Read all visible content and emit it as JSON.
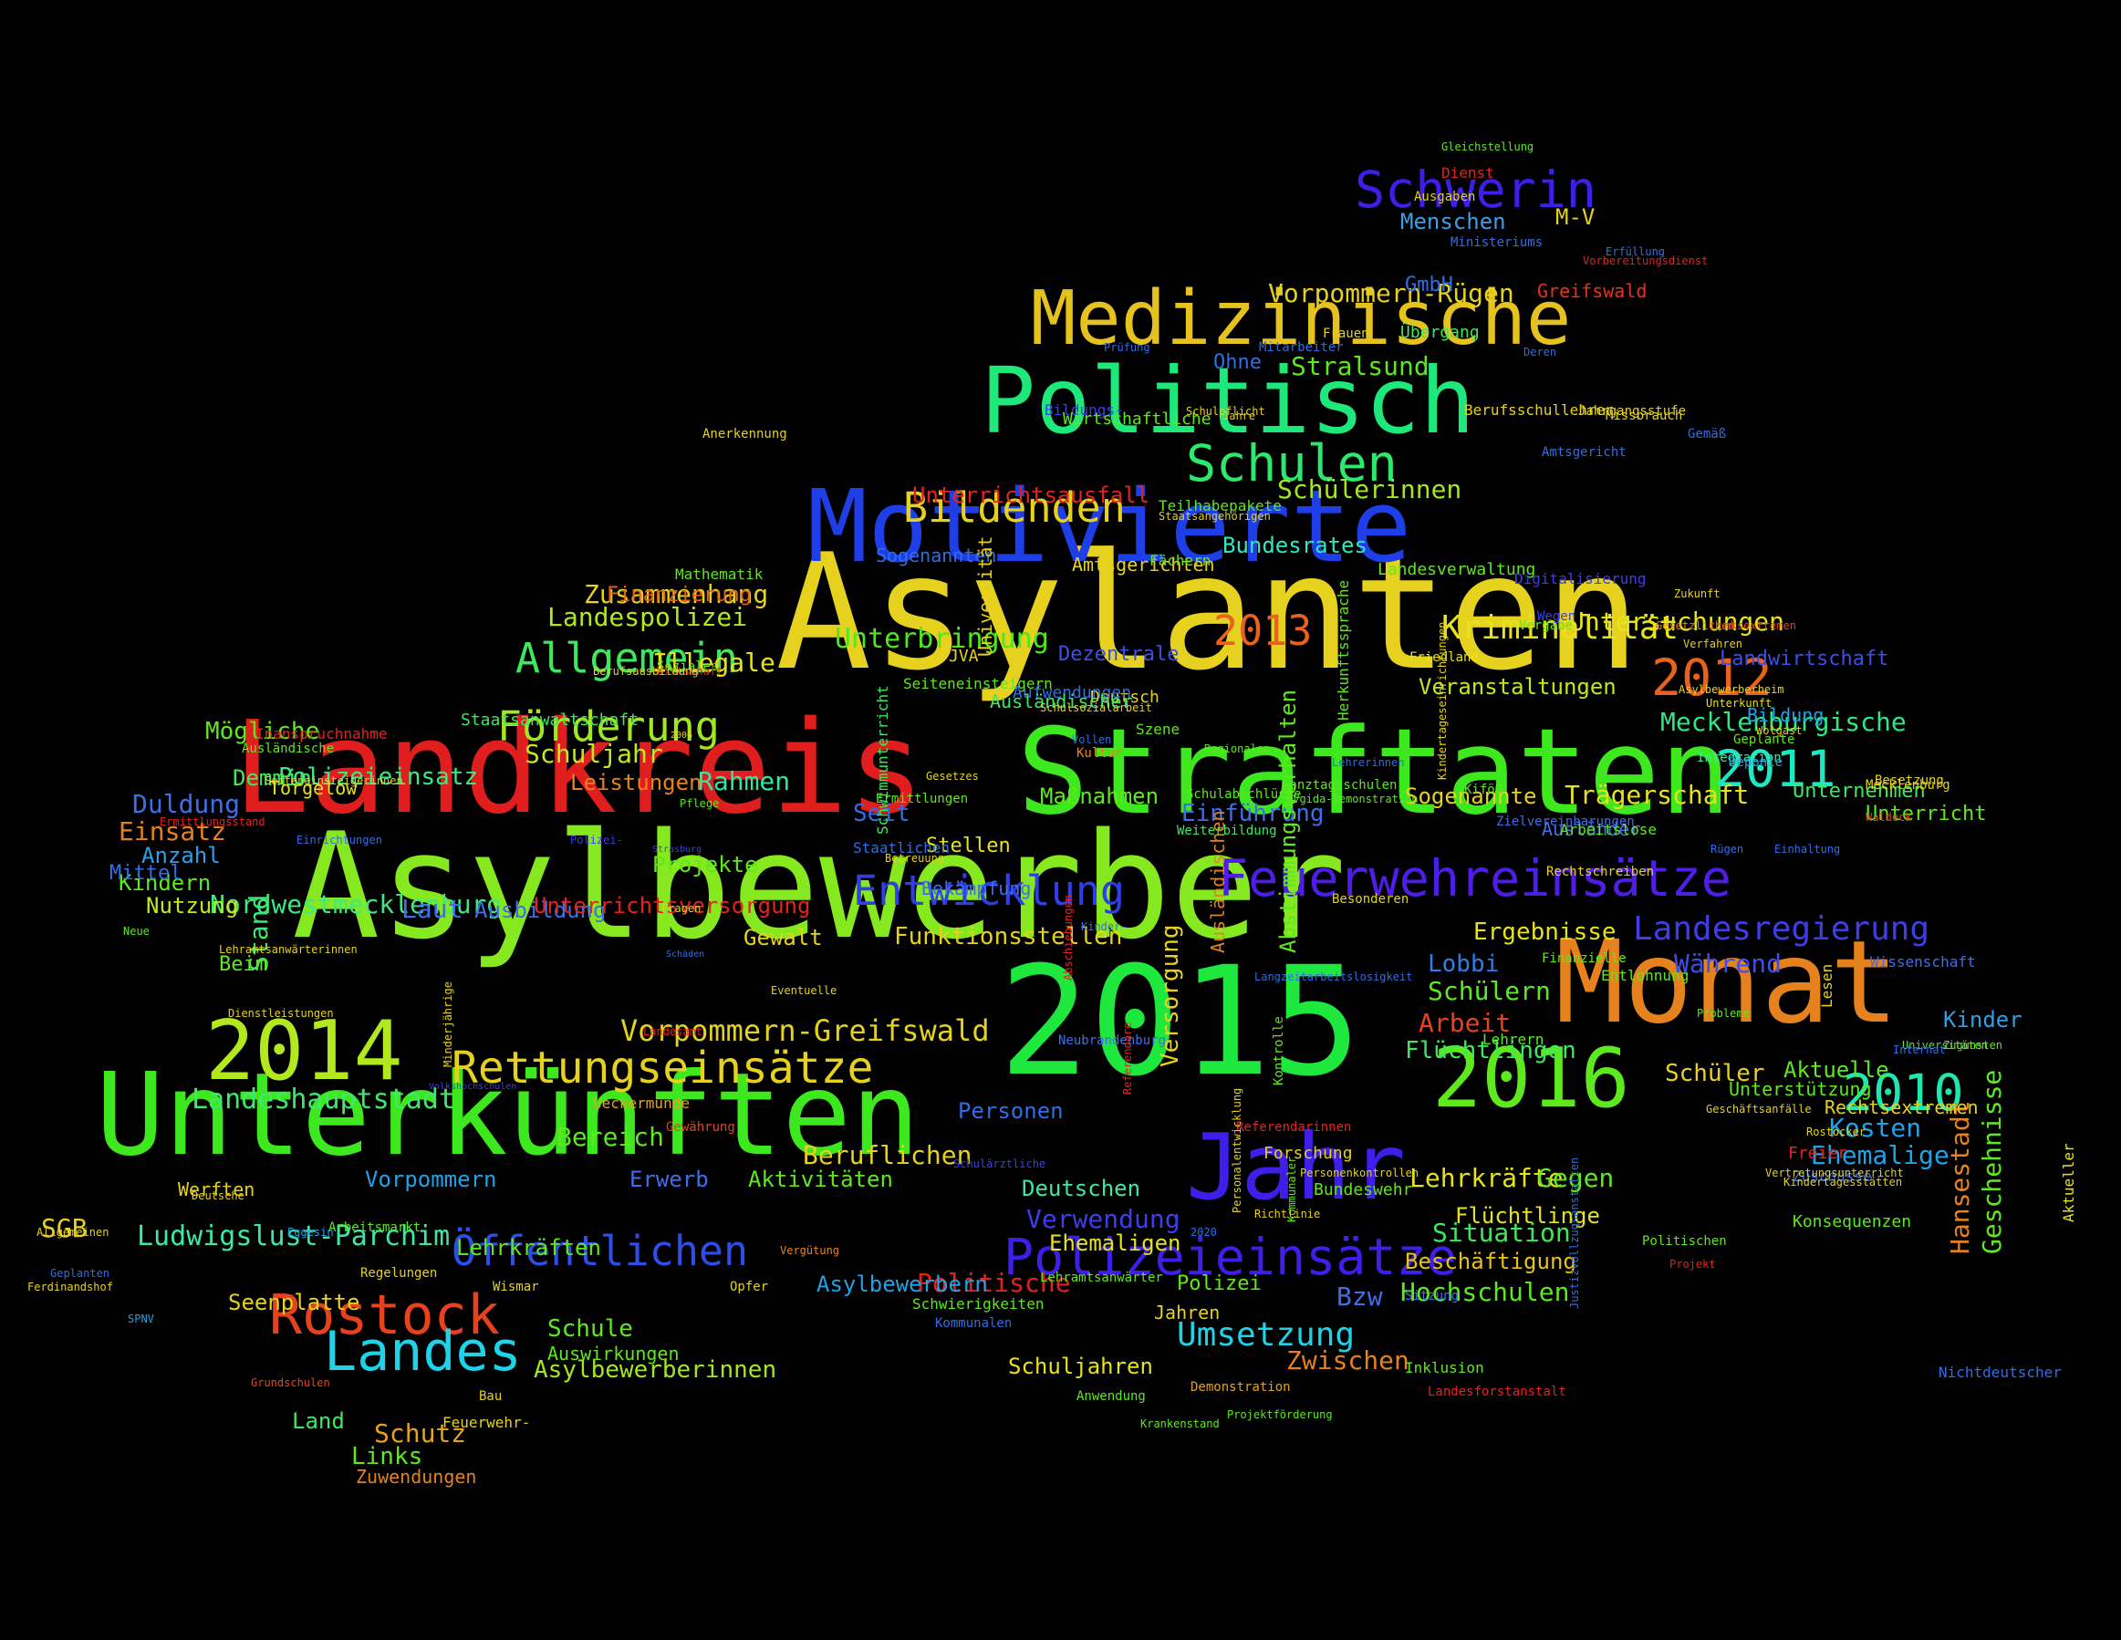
{
  "words": [
    {
      "text": "Asylanten",
      "color": "#e6d21e"
    },
    {
      "text": "Asylbewerber",
      "color": "#86e81e"
    },
    {
      "text": "Landkreis",
      "color": "#e01e1e"
    },
    {
      "text": "Straftaten",
      "color": "#3ee81e"
    },
    {
      "text": "Unterkünften",
      "color": "#3ee81e"
    },
    {
      "text": "2015",
      "color": "#1ee83e"
    },
    {
      "text": "Monat",
      "color": "#e6821e"
    },
    {
      "text": "Motivierte",
      "color": "#1e3ee8"
    },
    {
      "text": "Politisch",
      "color": "#1ee87a"
    },
    {
      "text": "Medizinische",
      "color": "#e6c21e"
    },
    {
      "text": "Jahr",
      "color": "#3e1ee8"
    },
    {
      "text": "2014",
      "color": "#b2e81e"
    },
    {
      "text": "2016",
      "color": "#5ee81e"
    },
    {
      "text": "Rostock",
      "color": "#e6421e"
    },
    {
      "text": "Landes",
      "color": "#1ed2e8"
    },
    {
      "text": "Schwerin",
      "color": "#3e1ee8"
    },
    {
      "text": "Schulen",
      "color": "#2ee86e"
    },
    {
      "text": "Feuerwehreinsätze",
      "color": "#4e1ee8"
    },
    {
      "text": "Polizeieinsätze",
      "color": "#3e1ee8"
    },
    {
      "text": "Rettungseinsätze",
      "color": "#e6d21e"
    },
    {
      "text": "Entwicklung",
      "color": "#2e3ee8"
    },
    {
      "text": "Allgemein",
      "color": "#3ee85e"
    },
    {
      "text": "Förderung",
      "color": "#a2e81e"
    },
    {
      "text": "Bildenden",
      "color": "#e6d21e"
    },
    {
      "text": "2013",
      "color": "#e6621e"
    },
    {
      "text": "2012",
      "color": "#e6621e"
    },
    {
      "text": "2011",
      "color": "#1ee8c2"
    },
    {
      "text": "2010",
      "color": "#1ee8b2"
    },
    {
      "text": "Öffentlichen",
      "color": "#2e4ee8"
    },
    {
      "text": "Vorpommern-Greifswald",
      "color": "#e6d21e"
    },
    {
      "text": "Kriminalität",
      "color": "#e6e21e"
    },
    {
      "text": "Landesregierung",
      "color": "#3e3ee8"
    },
    {
      "text": "Unterbringung",
      "color": "#4ee81e"
    },
    {
      "text": "Umsetzung",
      "color": "#1ed2e8"
    },
    {
      "text": "Landeshauptstadt",
      "color": "#3ee86e"
    },
    {
      "text": "Ludwigslust-Parchim",
      "color": "#3ee8a2"
    },
    {
      "text": "Nordwestmecklenburg",
      "color": "#3ee882"
    },
    {
      "text": "Vorpommern-Rügen",
      "color": "#e6d21e"
    },
    {
      "text": "Mecklenburgische",
      "color": "#2ee882"
    },
    {
      "text": "Zusammenhang",
      "color": "#e6d21e"
    },
    {
      "text": "Landespolizei",
      "color": "#b2e81e"
    },
    {
      "text": "Illegale",
      "color": "#e6e21e"
    },
    {
      "text": "Schuljahr",
      "color": "#c2e81e"
    },
    {
      "text": "Polizeieinsatz",
      "color": "#3ee882"
    },
    {
      "text": "Rahmen",
      "color": "#2ee8a2"
    },
    {
      "text": "Leistungen",
      "color": "#e6821e"
    },
    {
      "text": "Mögliche",
      "color": "#5ee81e"
    },
    {
      "text": "Demmin",
      "color": "#3ee85e"
    },
    {
      "text": "Duldung",
      "color": "#3e6ee8"
    },
    {
      "text": "Einsatz",
      "color": "#e6821e"
    },
    {
      "text": "Anzahl",
      "color": "#2e9ee8"
    },
    {
      "text": "Kindern",
      "color": "#5ee81e"
    },
    {
      "text": "Nutzung",
      "color": "#c2e81e"
    },
    {
      "text": "Stand",
      "color": "#3ee86e"
    },
    {
      "text": "Beim",
      "color": "#5ee81e"
    },
    {
      "text": "Laut",
      "color": "#3e6ee8"
    },
    {
      "text": "Ausbildung",
      "color": "#3e6ee8"
    },
    {
      "text": "Unterrichtsversorgung",
      "color": "#e6221e"
    },
    {
      "text": "Unterrichtsausfall",
      "color": "#e6221e"
    },
    {
      "text": "Stralsund",
      "color": "#5ee81e"
    },
    {
      "text": "Ohne",
      "color": "#2e6ee8"
    },
    {
      "text": "Schülerinnen",
      "color": "#a2e81e"
    },
    {
      "text": "Bundesrates",
      "color": "#2ee8c2"
    },
    {
      "text": "Gewalt",
      "color": "#e6d21e"
    },
    {
      "text": "Funktionsstellen",
      "color": "#e6d21e"
    },
    {
      "text": "Versorgung",
      "color": "#e6d21e"
    },
    {
      "text": "Ergebnisse",
      "color": "#e6e21e"
    },
    {
      "text": "Lobbi",
      "color": "#2e7ee8"
    },
    {
      "text": "Schülern",
      "color": "#5ee81e"
    },
    {
      "text": "Während",
      "color": "#3e4ee8"
    },
    {
      "text": "Arbeit",
      "color": "#e6421e"
    },
    {
      "text": "Flüchtlingen",
      "color": "#3ee85e"
    },
    {
      "text": "Schüler",
      "color": "#e6d21e"
    },
    {
      "text": "Aktuelle",
      "color": "#5ee81e"
    },
    {
      "text": "Kinder",
      "color": "#2e9ee8"
    },
    {
      "text": "Kosten",
      "color": "#1ea2e8"
    },
    {
      "text": "Ehemalige",
      "color": "#1ea2e8"
    },
    {
      "text": "Hansestadt",
      "color": "#e6821e"
    },
    {
      "text": "Geschehnisse",
      "color": "#5ee81e"
    },
    {
      "text": "Personen",
      "color": "#2e6ee8"
    },
    {
      "text": "Bereich",
      "color": "#5ee81e"
    },
    {
      "text": "Beruflichen",
      "color": "#e6d21e"
    },
    {
      "text": "Aktivitäten",
      "color": "#5ee81e"
    },
    {
      "text": "Erwerb",
      "color": "#3e6ee8"
    },
    {
      "text": "Vorpommern",
      "color": "#1ea2e8"
    },
    {
      "text": "Deutschen",
      "color": "#3ee8a2"
    },
    {
      "text": "Verwendung",
      "color": "#3e3ee8"
    },
    {
      "text": "Ehemaligen",
      "color": "#e6e21e"
    },
    {
      "text": "Lehrkräfte",
      "color": "#e6e21e"
    },
    {
      "text": "Gegen",
      "color": "#5ee81e"
    },
    {
      "text": "Flüchtlinge",
      "color": "#e6e21e"
    },
    {
      "text": "Situation",
      "color": "#3ee85e"
    },
    {
      "text": "Beschäftigung",
      "color": "#e6c21e"
    },
    {
      "text": "Hochschulen",
      "color": "#5ee81e"
    },
    {
      "text": "Bzw",
      "color": "#3e6ee8"
    },
    {
      "text": "Zwischen",
      "color": "#e6821e"
    },
    {
      "text": "Politische",
      "color": "#e6221e"
    },
    {
      "text": "Polizei",
      "color": "#5ee81e"
    },
    {
      "text": "Jahren",
      "color": "#e6d21e"
    },
    {
      "text": "Schuljahren",
      "color": "#e6e21e"
    },
    {
      "text": "Asylbewerbern",
      "color": "#1ea2e8"
    },
    {
      "text": "Schule",
      "color": "#5ee81e"
    },
    {
      "text": "Auswirkungen",
      "color": "#5ee81e"
    },
    {
      "text": "Asylbewerberinnen",
      "color": "#a2e81e"
    },
    {
      "text": "Seenplatte",
      "color": "#e6d21e"
    },
    {
      "text": "Lehrkräften",
      "color": "#5ee81e"
    },
    {
      "text": "SGB",
      "color": "#e6d21e"
    },
    {
      "text": "Land",
      "color": "#3ee85e"
    },
    {
      "text": "Schutz",
      "color": "#e6a21e"
    },
    {
      "text": "Links",
      "color": "#5ee81e"
    },
    {
      "text": "Zuwendungen",
      "color": "#e6821e"
    },
    {
      "text": "Veranstaltungen",
      "color": "#c2e81e"
    },
    {
      "text": "Landwirtschaft",
      "color": "#3e4ee8"
    },
    {
      "text": "Bildung",
      "color": "#1ea2e8"
    },
    {
      "text": "Sogenannte",
      "color": "#e6d21e"
    },
    {
      "text": "Trägerschaft",
      "color": "#e6e21e"
    },
    {
      "text": "Ausländer",
      "color": "#3e6ee8"
    },
    {
      "text": "Unternehmen",
      "color": "#3ee85e"
    },
    {
      "text": "Unterricht",
      "color": "#5ee81e"
    },
    {
      "text": "Einführung",
      "color": "#3e6ee8"
    },
    {
      "text": "Maßnahmen",
      "color": "#5ee81e"
    },
    {
      "text": "Dezentrale",
      "color": "#3e4ee8"
    },
    {
      "text": "Untersuchungen",
      "color": "#e6e21e"
    },
    {
      "text": "Finanzierung",
      "color": "#e6621e"
    },
    {
      "text": "Seit",
      "color": "#2e6ee8"
    },
    {
      "text": "Stellen",
      "color": "#e6e21e"
    },
    {
      "text": "Bekämpfung",
      "color": "#3e6ee8"
    },
    {
      "text": "Projekte",
      "color": "#5ee81e"
    },
    {
      "text": "M-V",
      "color": "#e6d21e"
    },
    {
      "text": "GmbH",
      "color": "#2e6ee8"
    },
    {
      "text": "Menschen",
      "color": "#3e9ee8"
    },
    {
      "text": "Greifswald",
      "color": "#e6321e"
    },
    {
      "text": "Mittel",
      "color": "#2e6ee8"
    },
    {
      "text": "Sogenannten",
      "color": "#2e6ee8"
    },
    {
      "text": "Amtsgerichten",
      "color": "#e6d21e"
    },
    {
      "text": "Vergabe",
      "color": "#5ee81e"
    },
    {
      "text": "Torgelow",
      "color": "#e6e21e"
    },
    {
      "text": "Staatsanwaltschaft",
      "color": "#3ee85e"
    },
    {
      "text": "Gleichstellung",
      "color": "#5ee81e"
    },
    {
      "text": "Dienst",
      "color": "#e6221e"
    },
    {
      "text": "Ausgaben",
      "color": "#e6d21e"
    },
    {
      "text": "Ministeriums",
      "color": "#2e6ee8"
    },
    {
      "text": "Frauen",
      "color": "#e6d21e"
    },
    {
      "text": "Übergang",
      "color": "#3ee85e"
    },
    {
      "text": "Bildungs-",
      "color": "#3e3ee8"
    },
    {
      "text": "Berufsschullehrer",
      "color": "#e6d21e"
    },
    {
      "text": "Jahrgangsstufe",
      "color": "#e6d21e"
    },
    {
      "text": "Staatlichen",
      "color": "#2e6ee8"
    },
    {
      "text": "Werften",
      "color": "#e6d21e"
    },
    {
      "text": "Gewährung",
      "color": "#e6421e"
    },
    {
      "text": "Wissenschaft",
      "color": "#3e6ee8"
    },
    {
      "text": "Rechtsextremen",
      "color": "#e6d21e"
    },
    {
      "text": "Unterstützung",
      "color": "#5ee81e"
    },
    {
      "text": "Bundeswehr",
      "color": "#5ee81e"
    },
    {
      "text": "Forschung",
      "color": "#e6d21e"
    },
    {
      "text": "Freier",
      "color": "#e6221e"
    },
    {
      "text": "Zuschüsse",
      "color": "#3e6ee8"
    },
    {
      "text": "Konsequenzen",
      "color": "#5ee81e"
    },
    {
      "text": "Nichtdeutscher",
      "color": "#2e6ee8"
    },
    {
      "text": "Aktueller",
      "color": "#e6e21e"
    },
    {
      "text": "Ausländischen",
      "color": "#e6821e"
    },
    {
      "text": "Herkunftssprache",
      "color": "#5ee81e"
    },
    {
      "text": "Abstimmungsverhalten",
      "color": "#5ee81e"
    },
    {
      "text": "Szene",
      "color": "#5ee81e"
    },
    {
      "text": "Integration",
      "color": "#3ee8a2"
    },
    {
      "text": "Geplante",
      "color": "#5ee81e"
    },
    {
      "text": "Deponie",
      "color": "#1ea2e8"
    },
    {
      "text": "Wolgast",
      "color": "#e6d21e"
    },
    {
      "text": "Mecklenburg",
      "color": "#e6d21e"
    },
    {
      "text": "Ueckermünde",
      "color": "#e6a21e"
    },
    {
      "text": "Kommunalen",
      "color": "#2e6ee8"
    },
    {
      "text": "Regelungen",
      "color": "#e6d21e"
    },
    {
      "text": "Mathematik",
      "color": "#5ee81e"
    },
    {
      "text": "Landesverwaltung",
      "color": "#5ee81e"
    },
    {
      "text": "Digitalisierung",
      "color": "#3e3ee8"
    },
    {
      "text": "Fächern",
      "color": "#5ee81e"
    },
    {
      "text": "Ermittlungen",
      "color": "#5ee81e"
    },
    {
      "text": "Universität",
      "color": "#e6d21e"
    },
    {
      "text": "Kultur",
      "color": "#e6821e"
    },
    {
      "text": "Wegen",
      "color": "#3e3ee8"
    },
    {
      "text": "Friedland",
      "color": "#e6e21e"
    },
    {
      "text": "Deutsch",
      "color": "#e6d21e"
    },
    {
      "text": "Seiteneinsteigern",
      "color": "#5ee81e"
    },
    {
      "text": "Aufwendungen",
      "color": "#2e6ee8"
    },
    {
      "text": "Ausländischer",
      "color": "#3ee85e"
    },
    {
      "text": "JVA",
      "color": "#e6d21e"
    },
    {
      "text": "Schulabschlüsse",
      "color": "#5ee81e"
    },
    {
      "text": "Ganztagsschulen",
      "color": "#5ee81e"
    },
    {
      "text": "KiföG",
      "color": "#5ee81e"
    },
    {
      "text": "Zielvereinbarungen",
      "color": "#3e6ee8"
    },
    {
      "text": "Weiterbildung",
      "color": "#3ee85e"
    },
    {
      "text": "Arbeitslose",
      "color": "#5ee81e"
    },
    {
      "text": "Schwimmunterricht",
      "color": "#3ee85e"
    },
    {
      "text": "Rechtschreiben",
      "color": "#e6d21e"
    },
    {
      "text": "Besonderen",
      "color": "#e6d21e"
    },
    {
      "text": "Finanzielle",
      "color": "#5ee81e"
    },
    {
      "text": "Entlohnung",
      "color": "#5ee81e"
    },
    {
      "text": "Lehrern",
      "color": "#5ee81e"
    },
    {
      "text": "Neubrandenburg",
      "color": "#3e6ee8"
    },
    {
      "text": "Kontrolle",
      "color": "#5ee81e"
    },
    {
      "text": "Sitzung",
      "color": "#3e6ee8"
    },
    {
      "text": "Inklusion",
      "color": "#5ee81e"
    },
    {
      "text": "Landesforstanstalt",
      "color": "#e6221e"
    },
    {
      "text": "Demonstration",
      "color": "#e6a21e"
    },
    {
      "text": "Schwierigkeiten",
      "color": "#5ee81e"
    },
    {
      "text": "Lehramtsanwärter",
      "color": "#5ee81e"
    },
    {
      "text": "Projektförderung",
      "color": "#5ee81e"
    },
    {
      "text": "Krankenstand",
      "color": "#5ee81e"
    },
    {
      "text": "Anwendung",
      "color": "#5ee81e"
    },
    {
      "text": "Feuerwehr-",
      "color": "#e6d21e"
    },
    {
      "text": "Bau",
      "color": "#e6d21e"
    },
    {
      "text": "Wismar",
      "color": "#e6d21e"
    },
    {
      "text": "Opfer",
      "color": "#e6d21e"
    },
    {
      "text": "Vergütung",
      "color": "#e6821e"
    },
    {
      "text": "Landesamt",
      "color": "#e6221e"
    },
    {
      "text": "Arbeitsmarkt",
      "color": "#5ee81e"
    },
    {
      "text": "Eggesin",
      "color": "#1ea2e8"
    },
    {
      "text": "Deutsche",
      "color": "#e6d21e"
    },
    {
      "text": "Allgemeinen",
      "color": "#e6d21e"
    },
    {
      "text": "Geplanten",
      "color": "#2e6ee8"
    },
    {
      "text": "Ferdinandshof",
      "color": "#e6d21e"
    },
    {
      "text": "SPNV",
      "color": "#1ea2e8"
    },
    {
      "text": "Grundschulen",
      "color": "#e6421e"
    },
    {
      "text": "Inanspruchnahme",
      "color": "#e6221e"
    },
    {
      "text": "Ausländische",
      "color": "#5ee81e"
    },
    {
      "text": "Seiteneinsteigerinnen",
      "color": "#e6d21e"
    },
    {
      "text": "Ermittlungsstand",
      "color": "#e6221e"
    },
    {
      "text": "Einrichtungen",
      "color": "#2e6ee8"
    },
    {
      "text": "Neue",
      "color": "#5ee81e"
    },
    {
      "text": "Lehramtsanwärterinnen",
      "color": "#e6d21e"
    },
    {
      "text": "Dienstleistungen",
      "color": "#e6d21e"
    },
    {
      "text": "Soziales",
      "color": "#5ee81e"
    },
    {
      "text": "Pflege",
      "color": "#5ee81e"
    },
    {
      "text": "Wirtschaft",
      "color": "#e6221e"
    },
    {
      "text": "Berufsausbildung",
      "color": "#e6d21e"
    },
    {
      "text": "Schulsozialarbeit",
      "color": "#e6d21e"
    },
    {
      "text": "Jahre",
      "color": "#e6d21e"
    },
    {
      "text": "Wirtschaftliche",
      "color": "#5ee81e"
    },
    {
      "text": "Anerkennung",
      "color": "#e6d21e"
    },
    {
      "text": "Teilhabepakete",
      "color": "#5ee81e"
    },
    {
      "text": "Schulpflicht",
      "color": "#e6d21e"
    },
    {
      "text": "Gemäß",
      "color": "#2e6ee8"
    },
    {
      "text": "Eventuelle",
      "color": "#e6d21e"
    },
    {
      "text": "Deren",
      "color": "#2e6ee8"
    },
    {
      "text": "Amtsgericht",
      "color": "#2e6ee8"
    },
    {
      "text": "Prüfung",
      "color": "#2e6ee8"
    },
    {
      "text": "Mitarbeiter",
      "color": "#2e6ee8"
    },
    {
      "text": "Missbrauch",
      "color": "#e6d21e"
    },
    {
      "text": "Staatsangehörigen",
      "color": "#e6d21e"
    },
    {
      "text": "Zukunft",
      "color": "#e6d21e"
    },
    {
      "text": "Erfüllung",
      "color": "#2e6ee8"
    },
    {
      "text": "Vorbereitungsdienst",
      "color": "#e6221e"
    },
    {
      "text": "Gesetzlichen",
      "color": "#e6821e"
    },
    {
      "text": "Linksextremen",
      "color": "#e6421e"
    },
    {
      "text": "Verfahren",
      "color": "#e6d21e"
    },
    {
      "text": "Asylbewerberheim",
      "color": "#e6d21e"
    },
    {
      "text": "Unterkunft",
      "color": "#e6e21e"
    },
    {
      "text": "Besetzung",
      "color": "#e6d21e"
    },
    {
      "text": "Waldeck",
      "color": "#e6421e"
    },
    {
      "text": "Einhaltung",
      "color": "#2e6ee8"
    },
    {
      "text": "Rügen",
      "color": "#2e6ee8"
    },
    {
      "text": "Probleme",
      "color": "#5ee81e"
    },
    {
      "text": "Universitäten",
      "color": "#5ee81e"
    },
    {
      "text": "Lesen",
      "color": "#e6d21e"
    },
    {
      "text": "Zugunsten",
      "color": "#5ee81e"
    },
    {
      "text": "Internat",
      "color": "#2e6ee8"
    },
    {
      "text": "Rostocker",
      "color": "#e6d21e"
    },
    {
      "text": "Kindertagesstätten",
      "color": "#e6d21e"
    },
    {
      "text": "Vertretungsunterricht",
      "color": "#e6d21e"
    },
    {
      "text": "Geschäftsanfälle",
      "color": "#e6d21e"
    },
    {
      "text": "Projekt",
      "color": "#e6221e"
    },
    {
      "text": "Politischen",
      "color": "#5ee81e"
    },
    {
      "text": "Justizvollzugsanstalten",
      "color": "#2e6ee8"
    },
    {
      "text": "Personenkontrollen",
      "color": "#e6d21e"
    },
    {
      "text": "Referendarinnen",
      "color": "#e6221e"
    },
    {
      "text": "Kommunaler",
      "color": "#5ee81e"
    },
    {
      "text": "Personalentwicklung",
      "color": "#e6d21e"
    },
    {
      "text": "Richtlinie",
      "color": "#e6d21e"
    },
    {
      "text": "2020",
      "color": "#2e6ee8"
    },
    {
      "text": "Referendare",
      "color": "#e6221e"
    },
    {
      "text": "Abschiebungen",
      "color": "#e6221e"
    },
    {
      "text": "Langzeitarbeitslosigkeit",
      "color": "#2e6ee8"
    },
    {
      "text": "Kinder-",
      "color": "#3e6ee8"
    },
    {
      "text": "Schulärztliche",
      "color": "#3e3ee8"
    },
    {
      "text": "Volkshochschulen",
      "color": "#3e3ee8"
    },
    {
      "text": "Minderjährige",
      "color": "#e6d21e"
    },
    {
      "text": "Fragen",
      "color": "#e6d21e"
    },
    {
      "text": "Schäden",
      "color": "#2e6ee8"
    },
    {
      "text": "Betreuung",
      "color": "#e6d21e"
    },
    {
      "text": "Polizei-",
      "color": "#3e3ee8"
    },
    {
      "text": "Strasburg",
      "color": "#3e3ee8"
    },
    {
      "text": "2006",
      "color": "#e6d21e"
    },
    {
      "text": "Regionalen",
      "color": "#5ee81e"
    },
    {
      "text": "Lehrerinnen",
      "color": "#2e6ee8"
    },
    {
      "text": "Gesetzes",
      "color": "#e6d21e"
    },
    {
      "text": "Vollen",
      "color": "#2e6ee8"
    },
    {
      "text": "Kindertageseinrichtungen",
      "color": "#e6d21e"
    },
    {
      "text": "MVgida-Demonstration",
      "color": "#5ee81e"
    }
  ]
}
